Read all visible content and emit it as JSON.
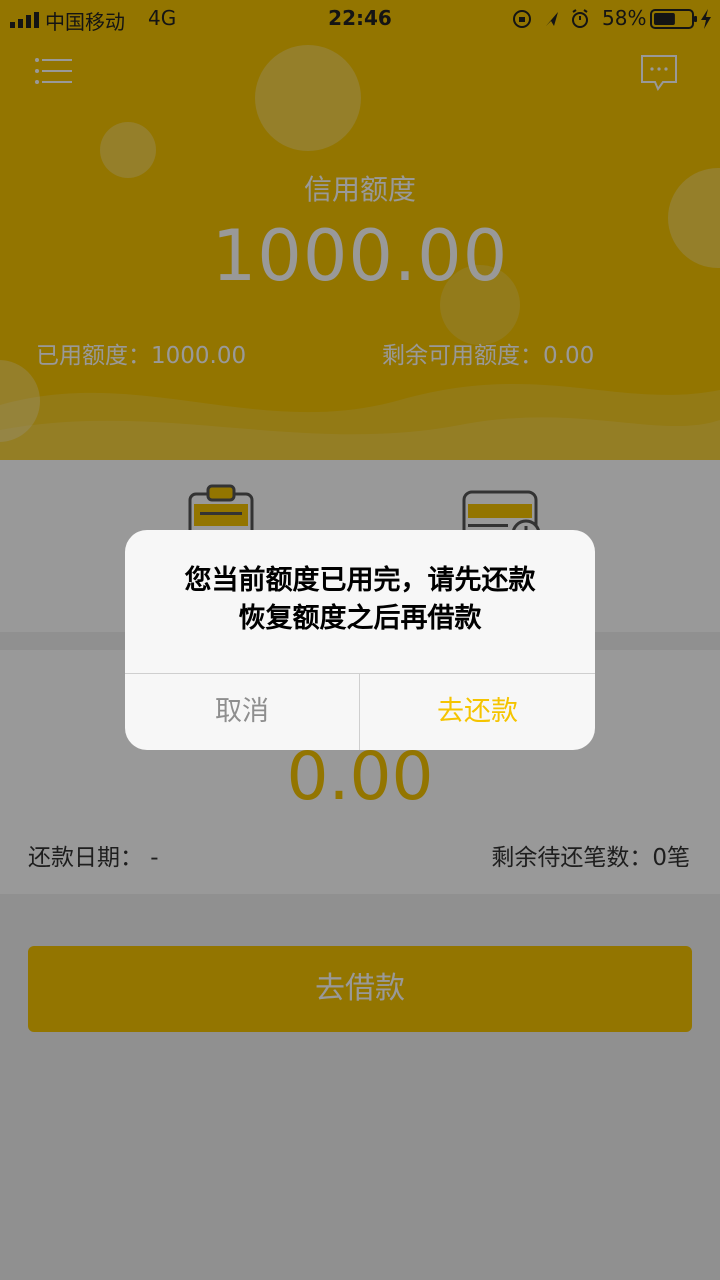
{
  "status_bar": {
    "carrier": "中国移动",
    "network": "4G",
    "time": "22:46",
    "battery_percent": "58%",
    "battery_level": 0.58
  },
  "header": {
    "menu_icon": "menu-icon",
    "message_icon": "message-icon",
    "credit_title": "信用额度",
    "credit_amount": "1000.00",
    "used_label": "已用额度：1000.00",
    "remaining_label": "剩余可用额度：0.00"
  },
  "actions": {
    "icons": [
      "clipboard-icon",
      "card-clock-icon"
    ]
  },
  "repayment": {
    "amount": "0.00",
    "date_label": "还款日期：  -",
    "count_label": "剩余待还笔数：0笔"
  },
  "borrow_button": "去借款",
  "dialog": {
    "line1": "您当前额度已用完，请先还款",
    "line2": "恢复额度之后再借款",
    "cancel": "取消",
    "confirm": "去还款"
  },
  "colors": {
    "accent": "#f5c400",
    "overlay": "rgba(0,0,0,0.4)"
  }
}
